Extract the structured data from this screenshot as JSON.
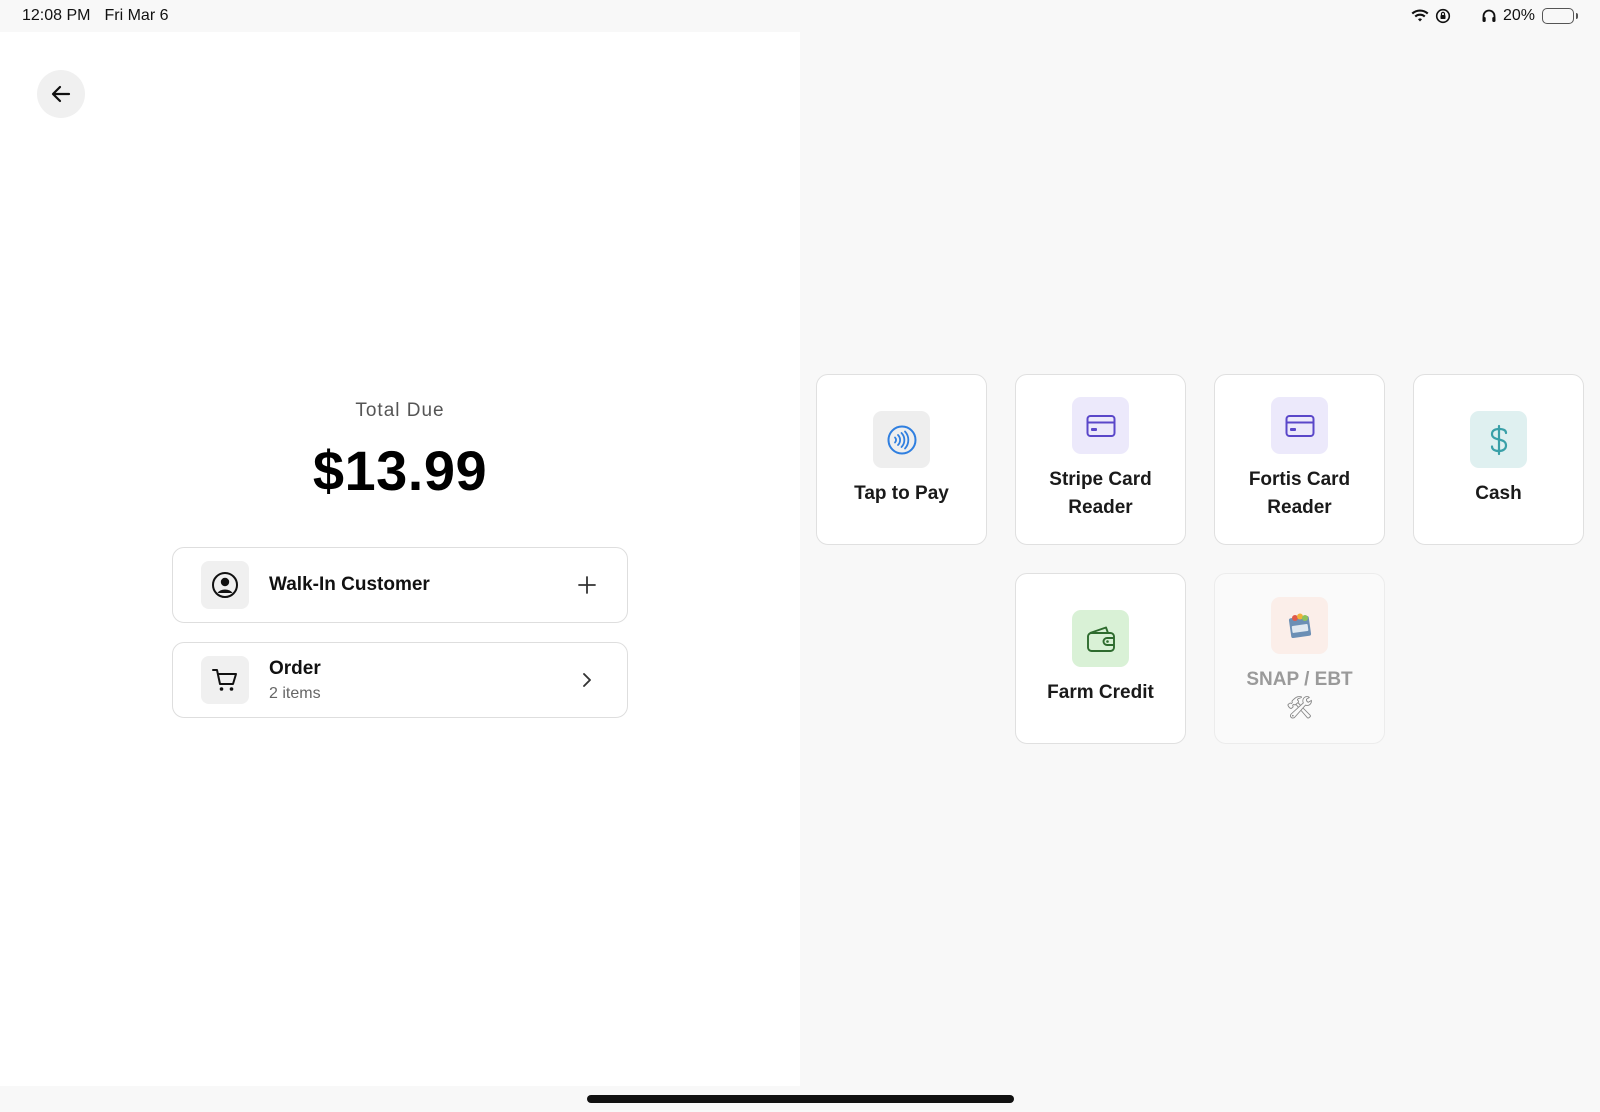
{
  "status_bar": {
    "time": "12:08 PM",
    "date": "Fri Mar 6",
    "battery_percent": "20%",
    "battery_level": 0.2,
    "icons": [
      "wifi-icon",
      "orientation-lock-icon",
      "moon-icon",
      "headphones-icon",
      "battery-icon"
    ]
  },
  "left": {
    "back_icon": "arrow-left-icon",
    "total_label": "Total Due",
    "total_amount": "$13.99",
    "customer": {
      "title": "Walk-In Customer",
      "icon": "user-circle-icon",
      "action_icon": "plus-icon"
    },
    "order": {
      "title": "Order",
      "subtitle": "2 items",
      "icon": "cart-icon",
      "action_icon": "chevron-right-icon"
    }
  },
  "payment_methods": [
    {
      "label": "Tap to Pay",
      "icon": "contactless-icon",
      "icon_bg": "#eeeeee",
      "icon_color": "#2f7fe0",
      "enabled": true
    },
    {
      "label": "Stripe Card\nReader",
      "icon": "credit-card-icon",
      "icon_bg": "#ece9fb",
      "icon_color": "#5a47c9",
      "enabled": true
    },
    {
      "label": "Fortis Card\nReader",
      "icon": "credit-card-icon",
      "icon_bg": "#ece9fb",
      "icon_color": "#5a47c9",
      "enabled": true
    },
    {
      "label": "Cash",
      "icon": "dollar-icon",
      "icon_bg": "#dff0f0",
      "icon_color": "#3aa0a8",
      "enabled": true
    },
    {
      "label": "Farm Credit",
      "icon": "wallet-icon",
      "icon_bg": "#d9f1d6",
      "icon_color": "#2e6b2e",
      "enabled": true
    },
    {
      "label": "SNAP / EBT",
      "icon": "snap-logo-icon",
      "icon_bg": "#fbeee9",
      "icon_color": "#c96a4a",
      "enabled": false,
      "extra": "🛠"
    }
  ]
}
